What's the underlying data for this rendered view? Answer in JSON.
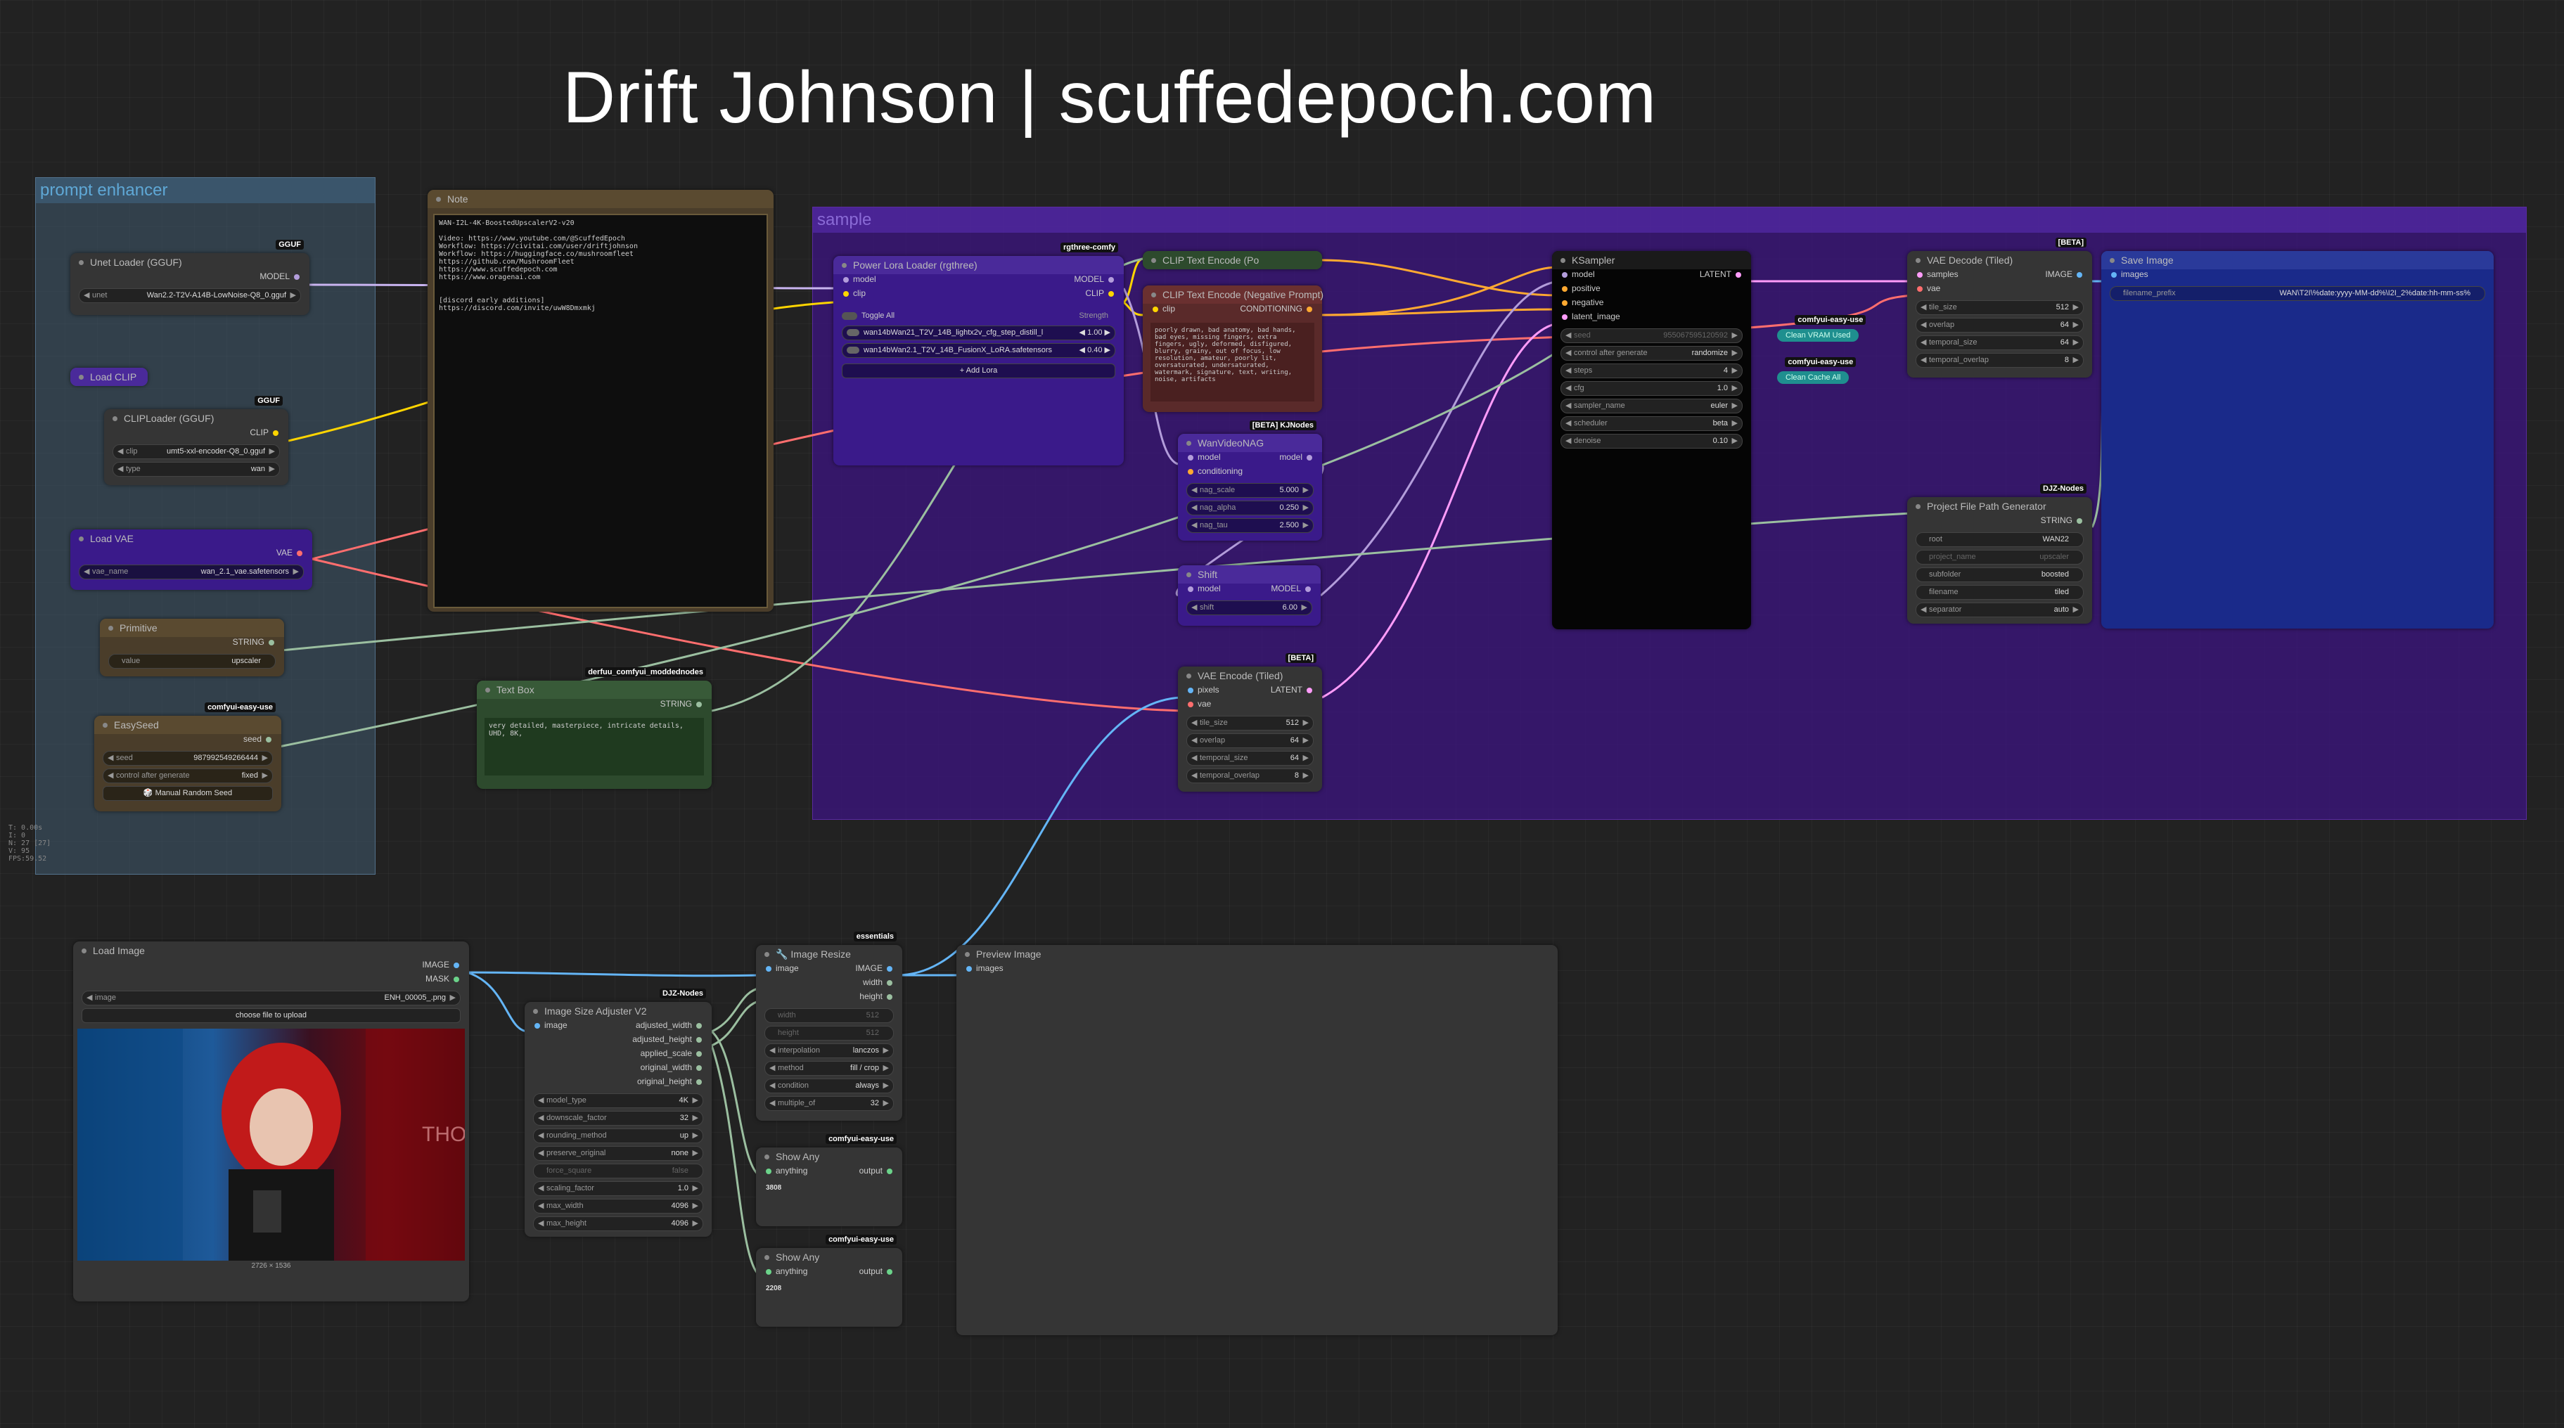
{
  "page_title": "Drift Johnson | scuffedepoch.com",
  "fps_info": [
    "T: 0.00s",
    "I: 0",
    "N: 27 [27]",
    "V: 95",
    "FPS:59.52"
  ],
  "groups": {
    "prompt_enhancer": "prompt enhancer",
    "sample": "sample"
  },
  "note": {
    "title": "Note",
    "text": "WAN-I2L-4K-BoostedUpscalerV2-v20\n\nVideo: https://www.youtube.com/@ScuffedEpoch\nWorkflow: https://civitai.com/user/driftjohnson\nWorkflow: https://huggingface.co/mushroomfleet\nhttps://github.com/MushroomFleet\nhttps://www.scuffedepoch.com\nhttps://www.oragenai.com\n\n\n[discord early additions]\nhttps://discord.com/invite/uwW8Dmxmkj"
  },
  "unet_loader": {
    "title": "Unet Loader (GGUF)",
    "badge": "GGUF",
    "output": "MODEL",
    "widget_label": "unet",
    "widget_value": "Wan2.2-T2V-A14B-LowNoise-Q8_0.gguf"
  },
  "load_clip": {
    "title": "Load CLIP"
  },
  "clip_loader": {
    "title": "CLIPLoader (GGUF)",
    "badge": "GGUF",
    "output": "CLIP",
    "clip_label": "clip",
    "clip_value": "umt5-xxl-encoder-Q8_0.gguf",
    "type_label": "type",
    "type_value": "wan"
  },
  "load_vae": {
    "title": "Load VAE",
    "output": "VAE",
    "widget_label": "vae_name",
    "widget_value": "wan_2.1_vae.safetensors"
  },
  "primitive": {
    "title": "Primitive",
    "output": "STRING",
    "widget_label": "value",
    "widget_value": "upscaler"
  },
  "easy_seed": {
    "title": "EasySeed",
    "badge": "comfyui-easy-use",
    "output": "seed",
    "seed_label": "seed",
    "seed_value": "987992549266444",
    "control_label": "control after generate",
    "control_value": "fixed",
    "button": "🎲 Manual Random Seed"
  },
  "text_box": {
    "title": "Text Box",
    "badge": "derfuu_comfyui_moddednodes",
    "output": "STRING",
    "text": "very detailed, masterpiece, intricate details, UHD, 8K,"
  },
  "power_lora": {
    "title": "Power Lora Loader (rgthree)",
    "badge": "rgthree-comfy",
    "inputs": [
      "model",
      "clip"
    ],
    "outputs": [
      "MODEL",
      "CLIP"
    ],
    "toggle_all": "Toggle All",
    "strength_header": "Strength",
    "loras": [
      {
        "name": "wan14bWan21_T2V_14B_lightx2v_cfg_step_distill_l",
        "strength": "1.00"
      },
      {
        "name": "wan14bWan2.1_T2V_14B_FusionX_LoRA.safetensors",
        "strength": "0.40"
      }
    ],
    "add_lora": "+ Add Lora"
  },
  "clip_positive": {
    "title": "CLIP Text Encode (Po"
  },
  "clip_negative": {
    "title": "CLIP Text Encode (Negative Prompt)",
    "input": "clip",
    "output": "CONDITIONING",
    "text": "poorly drawn, bad anatomy, bad hands, bad eyes, missing fingers, extra fingers, ugly, deformed, disfigured, blurry, grainy, out of focus, low resolution, amateur, poorly lit, oversaturated, undersaturated, watermark, signature, text, writing, noise, artifacts"
  },
  "wan_nag": {
    "title": "WanVideoNAG",
    "badge": "[BETA] KJNodes",
    "inputs": [
      "model",
      "conditioning"
    ],
    "output": "model",
    "widgets": [
      {
        "label": "nag_scale",
        "value": "5.000"
      },
      {
        "label": "nag_alpha",
        "value": "0.250"
      },
      {
        "label": "nag_tau",
        "value": "2.500"
      }
    ]
  },
  "shift": {
    "title": "Shift",
    "input": "model",
    "output": "MODEL",
    "widget_label": "shift",
    "widget_value": "6.00"
  },
  "vae_encode": {
    "title": "VAE Encode (Tiled)",
    "badge": "[BETA]",
    "inputs": [
      "pixels",
      "vae"
    ],
    "output": "LATENT",
    "widgets": [
      {
        "label": "tile_size",
        "value": "512"
      },
      {
        "label": "overlap",
        "value": "64"
      },
      {
        "label": "temporal_size",
        "value": "64"
      },
      {
        "label": "temporal_overlap",
        "value": "8"
      }
    ]
  },
  "ksampler": {
    "title": "KSampler",
    "inputs": [
      "model",
      "positive",
      "negative",
      "latent_image"
    ],
    "output": "LATENT",
    "widgets": [
      {
        "label": "seed",
        "value": "955067595120592",
        "disabled": true
      },
      {
        "label": "control after generate",
        "value": "randomize"
      },
      {
        "label": "steps",
        "value": "4"
      },
      {
        "label": "cfg",
        "value": "1.0"
      },
      {
        "label": "sampler_name",
        "value": "euler"
      },
      {
        "label": "scheduler",
        "value": "beta"
      },
      {
        "label": "denoise",
        "value": "0.10"
      }
    ]
  },
  "vae_decode": {
    "title": "VAE Decode (Tiled)",
    "badge": "[BETA]",
    "inputs": [
      "samples",
      "vae"
    ],
    "output": "IMAGE",
    "widgets": [
      {
        "label": "tile_size",
        "value": "512"
      },
      {
        "label": "overlap",
        "value": "64"
      },
      {
        "label": "temporal_size",
        "value": "64"
      },
      {
        "label": "temporal_overlap",
        "value": "8"
      }
    ]
  },
  "clean_vram": {
    "badge": "comfyui-easy-use",
    "label": "Clean VRAM Used"
  },
  "clean_cache": {
    "badge": "comfyui-easy-use",
    "label": "Clean Cache All"
  },
  "save_image": {
    "title": "Save Image",
    "input": "images",
    "widget_label": "filename_prefix",
    "widget_value": "WAN\\T2I\\%date:yyyy-MM-dd%\\I2I_2%date:hh-mm-ss%"
  },
  "project_path": {
    "title": "Project File Path Generator",
    "badge": "DJZ-Nodes",
    "output": "STRING",
    "widgets": [
      {
        "label": "root",
        "value": "WAN22"
      },
      {
        "label": "project_name",
        "value": "upscaler",
        "disabled": true
      },
      {
        "label": "subfolder",
        "value": "boosted"
      },
      {
        "label": "filename",
        "value": "tiled"
      },
      {
        "label": "separator",
        "value": "auto"
      }
    ]
  },
  "load_image": {
    "title": "Load Image",
    "outputs": [
      "IMAGE",
      "MASK"
    ],
    "image_label": "image",
    "image_value": "ENH_00005_.png",
    "upload_button": "choose file to upload",
    "caption": "2726 × 1536"
  },
  "size_adjuster": {
    "title": "Image Size Adjuster V2",
    "badge": "DJZ-Nodes",
    "input": "image",
    "outputs": [
      "adjusted_width",
      "adjusted_height",
      "applied_scale",
      "original_width",
      "original_height"
    ],
    "widgets": [
      {
        "label": "model_type",
        "value": "4K"
      },
      {
        "label": "downscale_factor",
        "value": "32"
      },
      {
        "label": "rounding_method",
        "value": "up"
      },
      {
        "label": "preserve_original",
        "value": "none"
      },
      {
        "label": "force_square",
        "value": "false"
      },
      {
        "label": "scaling_factor",
        "value": "1.0"
      },
      {
        "label": "max_width",
        "value": "4096"
      },
      {
        "label": "max_height",
        "value": "4096"
      }
    ]
  },
  "image_resize": {
    "title": "🔧 Image Resize",
    "badge": "essentials",
    "input": "image",
    "outputs": [
      "IMAGE",
      "width",
      "height"
    ],
    "widgets": [
      {
        "label": "width",
        "value": "512",
        "disabled": true
      },
      {
        "label": "height",
        "value": "512",
        "disabled": true
      },
      {
        "label": "interpolation",
        "value": "lanczos"
      },
      {
        "label": "method",
        "value": "fill / crop"
      },
      {
        "label": "condition",
        "value": "always"
      },
      {
        "label": "multiple_of",
        "value": "32"
      }
    ]
  },
  "show_any_1": {
    "title": "Show Any",
    "badge": "comfyui-easy-use",
    "input": "anything",
    "output": "output",
    "value": "3808"
  },
  "show_any_2": {
    "title": "Show Any",
    "badge": "comfyui-easy-use",
    "input": "anything",
    "output": "output",
    "value": "2208"
  },
  "preview_image": {
    "title": "Preview Image",
    "input": "images"
  },
  "colors": {
    "background": "#222222",
    "node_body": "#353535",
    "wire_model": "#b39ddb",
    "wire_clip": "#ffd500",
    "wire_vae": "#ff6e6e",
    "wire_latent": "#ff9cf9",
    "wire_image": "#64b5f6",
    "wire_conditioning": "#ffa931",
    "wire_string": "#9bbfa0",
    "purple_group": "#3a1a6a",
    "blue_group": "#2d3e4d"
  }
}
